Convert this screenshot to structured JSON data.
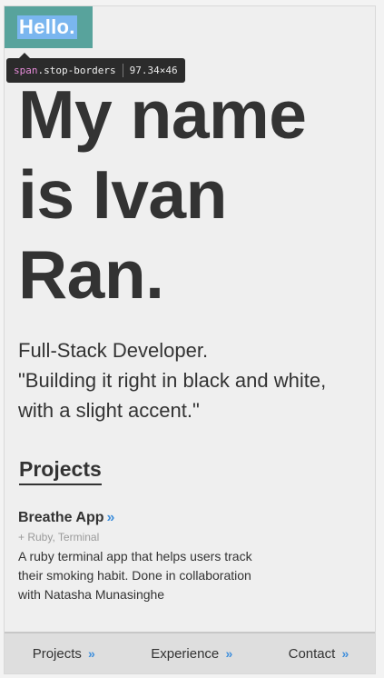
{
  "header": {
    "logo_text": "Hello."
  },
  "devtools_tooltip": {
    "tag": "span",
    "class_name": ".stop-borders",
    "size": "97.34×46"
  },
  "hero": {
    "headline_lines": [
      "My name",
      "is Ivan",
      "Ran."
    ],
    "tagline_lines": [
      "Full-Stack Developer.",
      "\"Building it right in black and white,",
      "with a slight accent.\""
    ]
  },
  "projects": {
    "heading": "Projects",
    "items": [
      {
        "title": "Breathe App",
        "arrow": "»",
        "tech": "+ Ruby, Terminal",
        "description_lines": [
          "A ruby terminal app that helps users track",
          "their smoking habit. Done in collaboration",
          "with Natasha Munasinghe"
        ]
      }
    ]
  },
  "bottom_nav": {
    "items": [
      {
        "label": "Projects",
        "arrow": "»"
      },
      {
        "label": "Experience",
        "arrow": "»"
      },
      {
        "label": "Contact",
        "arrow": "»"
      }
    ]
  },
  "colors": {
    "accent": "#3f8fdc",
    "logo_bg": "#58a39c",
    "logo_highlight": "#7ab6ef",
    "text": "#333333"
  }
}
